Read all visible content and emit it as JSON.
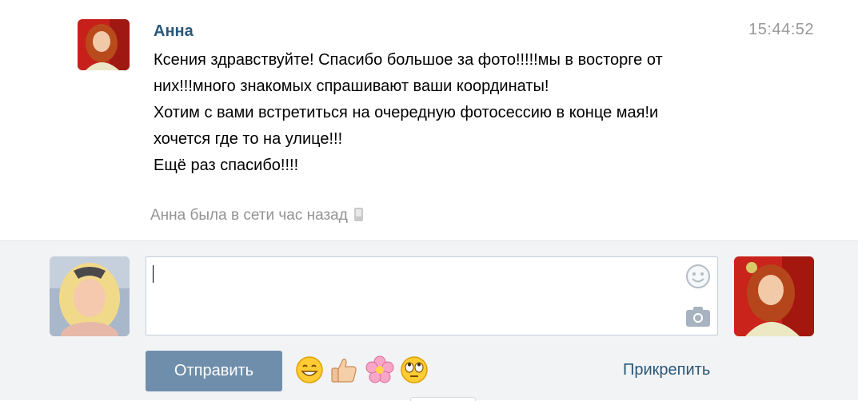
{
  "message": {
    "author": "Анна",
    "time": "15:44:52",
    "lines": [
      "Ксения здравствуйте! Спасибо большое за фото!!!!!мы в восторге от",
      "них!!!много знакомых спрашивают ваши координаты!",
      "Хотим с вами встретиться на очередную фотосессию в конце мая!и",
      "хочется где то на улице!!!",
      "Ещё раз спасибо!!!!"
    ]
  },
  "status": {
    "text": "Анна была в сети час назад",
    "icon": "mobile-phone-icon"
  },
  "composer": {
    "input_value": "",
    "send_label": "Отправить",
    "attach_label": "Прикрепить",
    "emoji_icons": [
      "smiling-face-icon",
      "thumbs-up-icon",
      "flower-icon",
      "eye-roll-face-icon"
    ],
    "input_icons": [
      "smile-icon",
      "camera-icon"
    ]
  },
  "colors": {
    "author": "#2b587a",
    "send_button": "#6f8eab",
    "link": "#2b587a",
    "muted": "#999999",
    "composer_bg": "#f2f3f5"
  }
}
